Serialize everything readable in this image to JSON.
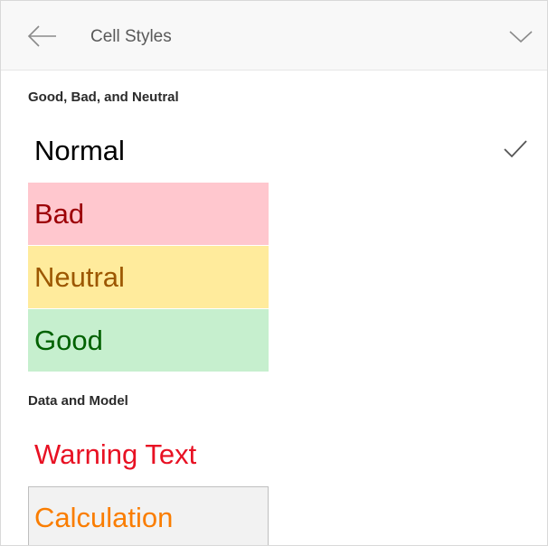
{
  "header": {
    "title": "Cell Styles",
    "back_icon": "back-arrow-icon",
    "collapse_icon": "chevron-down-icon"
  },
  "sections": [
    {
      "heading": "Good, Bad, and Neutral",
      "items": [
        {
          "label": "Normal",
          "background": "#ffffff",
          "color": "#000000",
          "selected": true
        },
        {
          "label": "Bad",
          "background": "#ffc7ce",
          "color": "#9c0006",
          "selected": false
        },
        {
          "label": "Neutral",
          "background": "#ffeb9c",
          "color": "#9c5700",
          "selected": false
        },
        {
          "label": "Good",
          "background": "#c6efce",
          "color": "#006100",
          "selected": false
        }
      ]
    },
    {
      "heading": "Data and Model",
      "items": [
        {
          "label": "Warning Text",
          "background": "#ffffff",
          "color": "#e81123",
          "selected": false
        },
        {
          "label": "Calculation",
          "background": "#f2f2f2",
          "color": "#fa7d00",
          "border": "#bfbfbf",
          "selected": false
        }
      ]
    }
  ],
  "selected_icon": "checkmark-icon"
}
